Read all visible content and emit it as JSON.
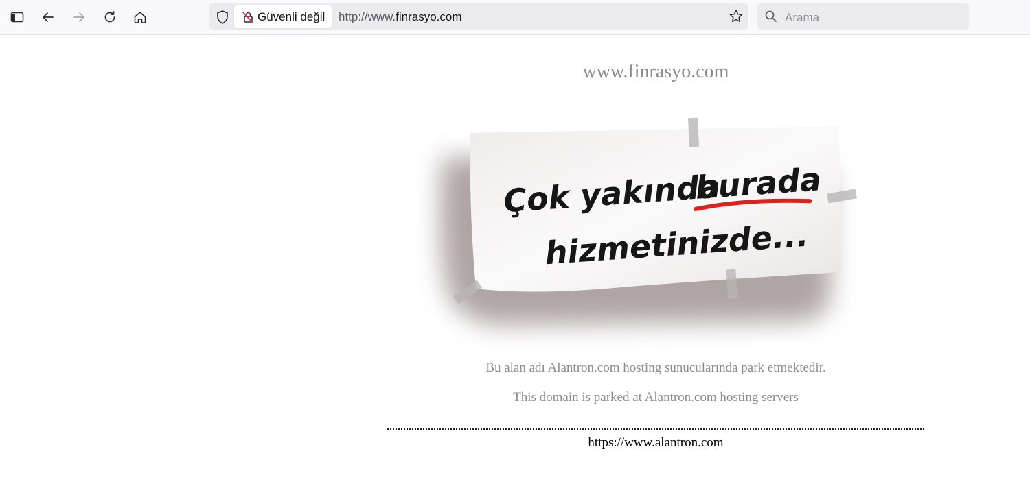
{
  "browser": {
    "security_label": "Güvenli değil",
    "url_prefix": "http://www.",
    "url_host": "finrasyo.com",
    "search_placeholder": "Arama"
  },
  "page": {
    "site_title": "www.finrasyo.com",
    "sign": {
      "line1_part1": "Çok yakında",
      "line1_part2": "burada",
      "line2": "hizmetinizde...",
      "underline_color": "#e0201c"
    },
    "notice_tr": "Bu alan adı Alantron.com hosting sunucularında park etmektedir.",
    "notice_en": "This domain is parked at Alantron.com hosting servers",
    "footer_link": "https://www.alantron.com"
  },
  "icons": [
    "sidebar-icon",
    "back-icon",
    "forward-icon",
    "reload-icon",
    "home-icon",
    "shield-icon",
    "insecure-lock-icon",
    "star-icon",
    "search-icon"
  ]
}
